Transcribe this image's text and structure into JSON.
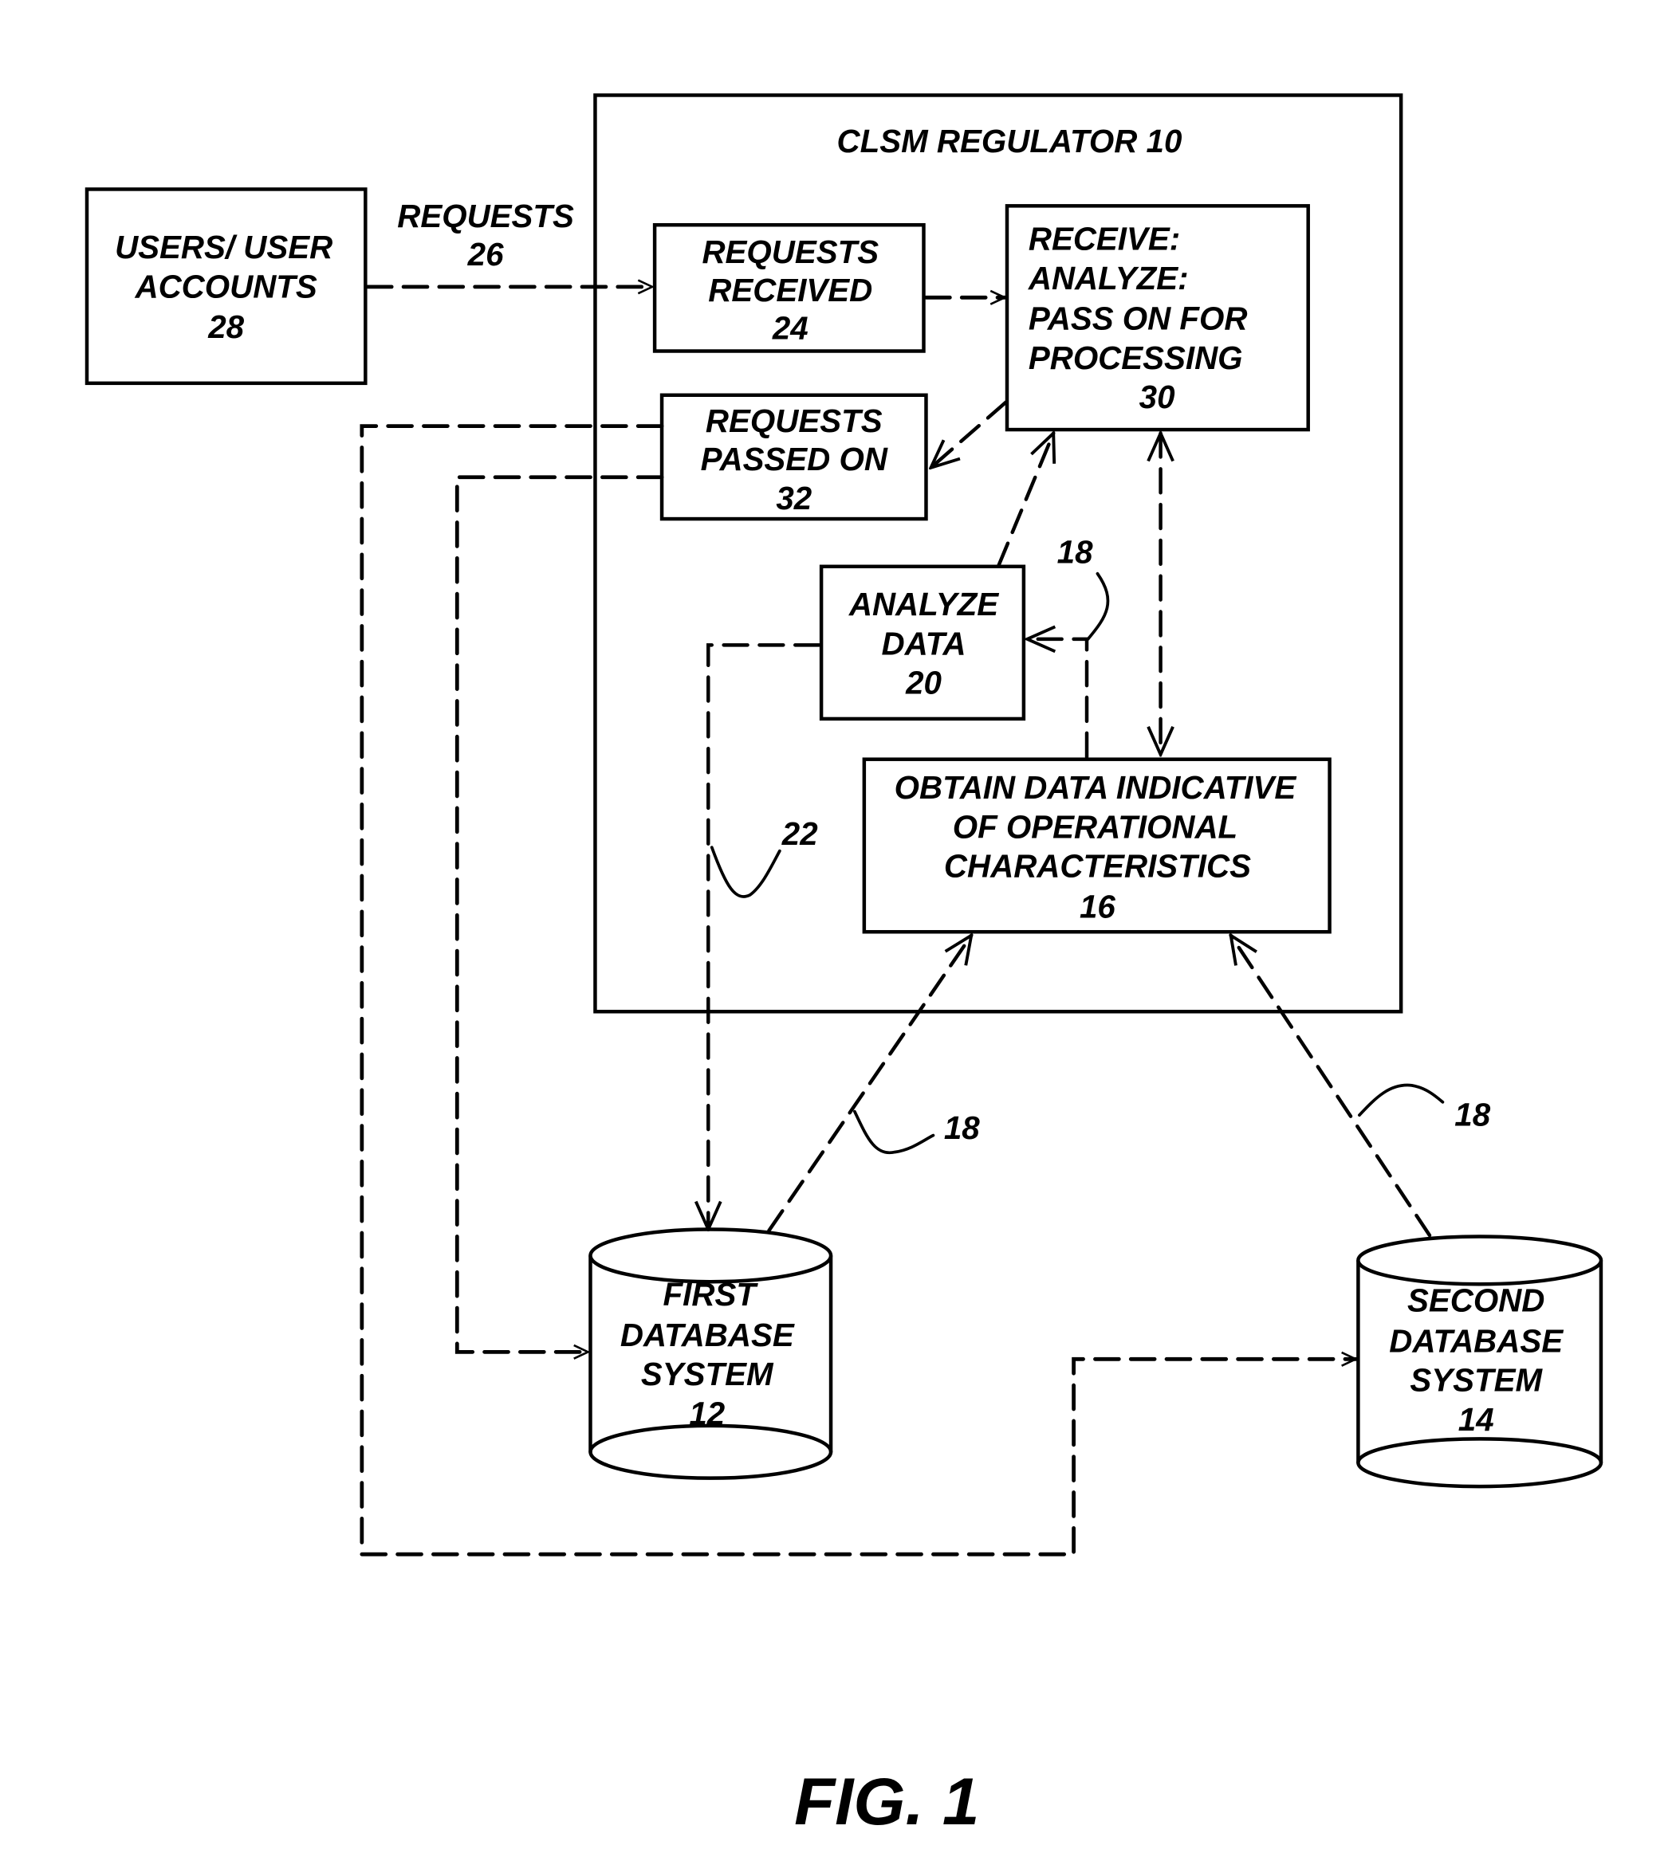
{
  "figure": {
    "caption": "FIG. 1",
    "regulator": {
      "title": "CLSM REGULATOR 10"
    },
    "nodes": {
      "users": {
        "lines": [
          "USERS/ USER",
          "ACCOUNTS",
          "28"
        ]
      },
      "requests_received": {
        "lines": [
          "REQUESTS",
          "RECEIVED",
          "24"
        ]
      },
      "receive_analyze": {
        "lines": [
          "RECEIVE:",
          "ANALYZE:",
          "PASS ON FOR",
          "PROCESSING",
          "30"
        ]
      },
      "requests_passed_on": {
        "lines": [
          "REQUESTS",
          "PASSED ON",
          "32"
        ]
      },
      "analyze_data": {
        "lines": [
          "ANALYZE",
          "DATA",
          "20"
        ]
      },
      "obtain_data": {
        "lines": [
          "OBTAIN DATA INDICATIVE",
          "OF OPERATIONAL",
          "CHARACTERISTICS",
          "16"
        ]
      },
      "first_db": {
        "lines": [
          "FIRST",
          "DATABASE",
          "SYSTEM",
          "12"
        ]
      },
      "second_db": {
        "lines": [
          "SECOND",
          "DATABASE",
          "SYSTEM",
          "14"
        ]
      }
    },
    "edge_labels": {
      "requests": [
        "REQUESTS",
        "26"
      ],
      "ref_18_top": "18",
      "ref_18_left": "18",
      "ref_18_right": "18",
      "ref_22": "22"
    },
    "edges": [
      {
        "from": "users",
        "to": "requests_received",
        "label": "REQUESTS 26",
        "style": "dashed"
      },
      {
        "from": "requests_received",
        "to": "receive_analyze",
        "style": "dashed"
      },
      {
        "from": "receive_analyze",
        "to": "requests_passed_on",
        "style": "dashed"
      },
      {
        "from": "analyze_data",
        "to": "receive_analyze",
        "style": "dashed"
      },
      {
        "from": "receive_analyze",
        "to": "obtain_data",
        "style": "dashed",
        "bidirectional": true
      },
      {
        "from": "obtain_data",
        "to": "analyze_data",
        "label": "18",
        "style": "dashed"
      },
      {
        "from": "first_db",
        "to": "obtain_data",
        "label": "18",
        "style": "dashed"
      },
      {
        "from": "second_db",
        "to": "obtain_data",
        "label": "18",
        "style": "dashed"
      },
      {
        "from": "analyze_data",
        "to": "first_db",
        "label": "22",
        "style": "dashed"
      },
      {
        "from": "requests_passed_on",
        "to": "first_db",
        "style": "dashed"
      },
      {
        "from": "requests_passed_on",
        "to": "second_db",
        "style": "dashed"
      }
    ]
  }
}
